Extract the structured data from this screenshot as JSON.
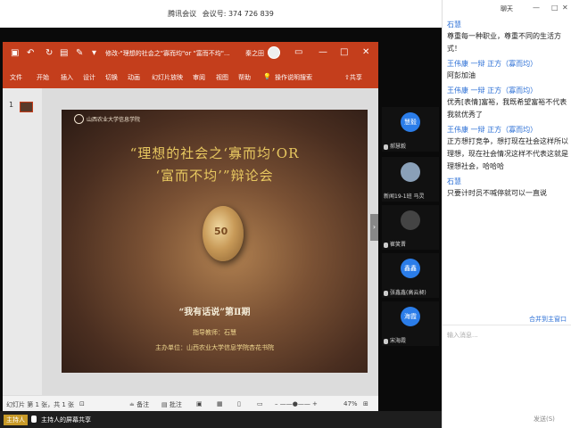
{
  "meeting": {
    "app_title": "腾讯会议",
    "meeting_id_label": "会议号: 374 726 839",
    "host_badge": "主持人",
    "screen_share_label": "主持人的屏幕共享"
  },
  "ppt": {
    "doc_title": "修改-\"理想的社会之\"寡而均\"or \"富而不均\"...",
    "user": "秦之田",
    "tabs": [
      "文件",
      "开始",
      "插入",
      "设计",
      "切换",
      "动画",
      "幻灯片放映",
      "审阅",
      "视图",
      "帮助",
      "操作说明搜索"
    ],
    "share_label": "共享",
    "thumb_number": "1",
    "status": {
      "slide_count": "幻灯片 第 1 张，共 1 张",
      "notes": "备注",
      "comments": "批注",
      "zoom": "47%"
    },
    "slide": {
      "logo_text": "山西农业大学信息学院",
      "title_line1": "“理想的社会之‘寡而均’OR",
      "title_line2": "‘富而不均’”辩论会",
      "coin_text": "50",
      "subtitle": "“我有话说”第Ⅱ期",
      "teacher": "指导教师：石慧",
      "organizer": "主办单位：山西农业大学信息学院杏花书院"
    }
  },
  "participants": [
    {
      "avatar_text": "慧毅",
      "name": "郝慧毅",
      "color": "#2b7de9"
    },
    {
      "avatar_text": "",
      "name": "新闻19-1班 马灵",
      "color": "#8aa0b8"
    },
    {
      "avatar_text": "",
      "name": "崔笑晋",
      "color": "#555555"
    },
    {
      "avatar_text": "鑫鑫",
      "name": "张鑫鑫(高云昶)",
      "color": "#2b7de9"
    },
    {
      "avatar_text": "海霞",
      "name": "宋海霞",
      "color": "#2b7de9"
    }
  ],
  "chat": {
    "title": "聊天",
    "messages": [
      {
        "name": "石慧",
        "text": "尊重每一种职业，尊重不同的生活方式！"
      },
      {
        "name": "王伟康 一辩 正方（寡而均）",
        "text": "阿彭加油"
      },
      {
        "name": "王伟康 一辩 正方（寡而均）",
        "text": "优秀[表情]富裕，我既希望富裕不代表我就优秀了"
      },
      {
        "name": "王伟康 一辩 正方（寡而均）",
        "text": "正方想打竞争，想打现在社会这样所以理想，现在社会情况这样不代表这就是理想社会，哈哈哈"
      },
      {
        "name": "石慧",
        "text": "只要计时员不喊停就可以一直说"
      }
    ],
    "pin_link": "合并到主窗口",
    "input_placeholder": "输入消息...",
    "send_label": "发送(S)"
  }
}
